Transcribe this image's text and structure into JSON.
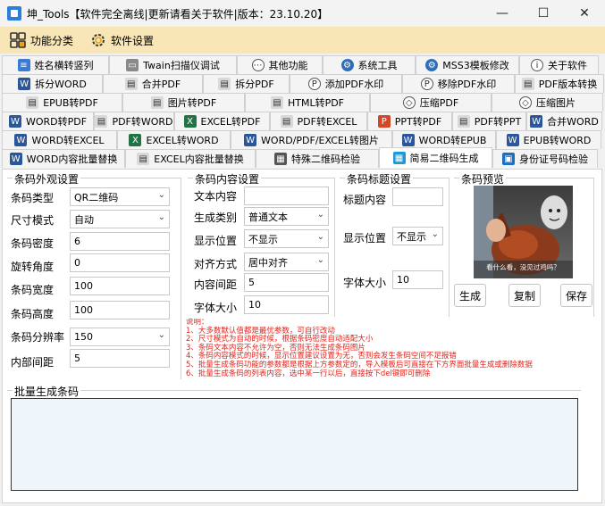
{
  "window": {
    "title": "坤_Tools【软件完全离线|更新请看关于软件|版本：23.10.20】",
    "minimize": "—",
    "maximize": "☐",
    "close": "✕"
  },
  "menu": [
    {
      "label": "功能分类",
      "icon": "grid-icon"
    },
    {
      "label": "软件设置",
      "icon": "gear-icon"
    }
  ],
  "tabs": {
    "row1": [
      "姓名横转竖列",
      "Twain扫描仪调试",
      "其他功能",
      "系统工具",
      "MSS3模板修改",
      "关于软件"
    ],
    "row2": [
      "拆分WORD",
      "合并PDF",
      "拆分PDF",
      "添加PDF水印",
      "移除PDF水印",
      "PDF版本转换"
    ],
    "row3": [
      "EPUB转PDF",
      "图片转PDF",
      "HTML转PDF",
      "压缩PDF",
      "压缩图片"
    ],
    "row4": [
      "WORD转PDF",
      "PDF转WORD",
      "EXCEL转PDF",
      "PDF转EXCEL",
      "PPT转PDF",
      "PDF转PPT",
      "合并WORD"
    ],
    "row5": [
      "WORD转EXCEL",
      "EXCEL转WORD",
      "WORD/PDF/EXCEL转图片",
      "WORD转EPUB",
      "EPUB转WORD"
    ],
    "row6": [
      "WORD内容批量替换",
      "EXCEL内容批量替换",
      "特殊二维码检验",
      "简易二维码生成",
      "身份证号码检验"
    ],
    "active": "简易二维码生成"
  },
  "appearance": {
    "title": "条码外观设置",
    "type_label": "条码类型",
    "type_value": "QR二维码",
    "size_mode_label": "尺寸模式",
    "size_mode_value": "自动",
    "density_label": "条码密度",
    "density_value": "6",
    "rotation_label": "旋转角度",
    "rotation_value": "0",
    "width_label": "条码宽度",
    "width_value": "100",
    "height_label": "条码高度",
    "height_value": "100",
    "resolution_label": "条码分辨率",
    "resolution_value": "150",
    "padding_label": "内部间距",
    "padding_value": "5"
  },
  "content": {
    "title": "条码内容设置",
    "text_label": "文本内容",
    "text_value": "",
    "gen_type_label": "生成类别",
    "gen_type_value": "普通文本",
    "display_pos_label": "显示位置",
    "display_pos_value": "不显示",
    "align_label": "对齐方式",
    "align_value": "居中对齐",
    "spacing_label": "内容间距",
    "spacing_value": "5",
    "font_size_label": "字体大小",
    "font_size_value": "10"
  },
  "caption": {
    "title": "条码标题设置",
    "content_label": "标题内容",
    "content_value": "",
    "display_pos_label": "显示位置",
    "display_pos_value": "不显示",
    "font_size_label": "字体大小",
    "font_size_value": "10"
  },
  "preview": {
    "title": "条码预览",
    "image_caption": "看什么看，没见过鸡吗？",
    "generate": "生成",
    "copy": "复制",
    "save": "保存"
  },
  "notes": [
    "说明：",
    "1、大多数默认值都是最优参数，可自行改动",
    "2、尺寸模式为自动的时候，根据条码密度自动适配大小",
    "3、条码文本内容不允许为空，否则无法生成条码图片",
    "4、条码内容模式的时候，显示位置建议设置为无，否则会发生条码空间不足报错",
    "5、批量生成条码功能的参数都是根据上方参数定的，导入模板后可直接在下方界面批量生成或删除数据",
    "6、批量生成条码的列表内容，选中某一行以后，直接按下del键即可删除"
  ],
  "batch": {
    "title": "批量生成条码"
  },
  "colors": {
    "menubar": "#f9e6b6",
    "notes": "#e0241b",
    "batch_bg": "#eef6fb"
  }
}
